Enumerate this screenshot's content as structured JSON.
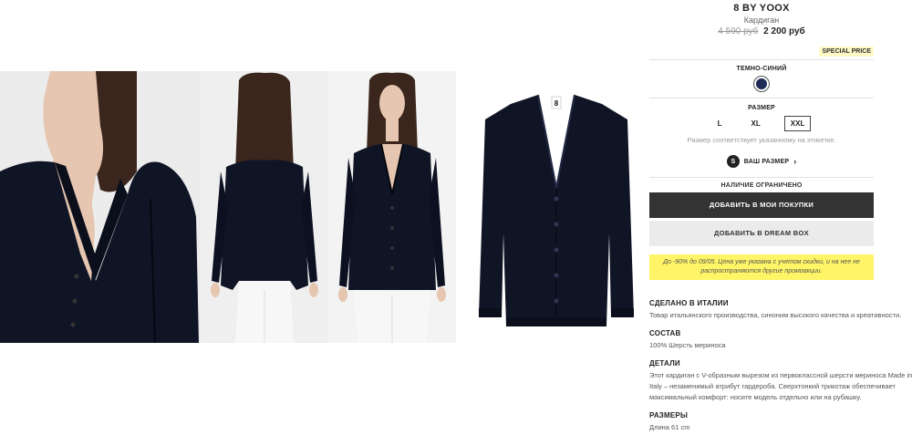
{
  "product": {
    "brand": "8 BY YOOX",
    "category": "Кардиган",
    "old_price": "4 590 руб",
    "new_price": "2 200 руб",
    "special_badge": "SPECIAL PRICE"
  },
  "color": {
    "label": "ТЕМНО-СИНИЙ",
    "swatch_hex": "#1d2b55"
  },
  "size": {
    "label": "РАЗМЕР",
    "options": [
      "L",
      "XL",
      "XXL"
    ],
    "selected": "XXL",
    "note": "Размер соответствует указанному на этикетке.",
    "your_size_badge": "S",
    "your_size_label": "ВАШ РАЗМЕР",
    "your_size_chevron": "›"
  },
  "stock": {
    "label": "НАЛИЧИЕ ОГРАНИЧЕНО"
  },
  "buttons": {
    "add_to_cart": "ДОБАВИТЬ В МОИ ПОКУПКИ",
    "add_to_dreambox": "ДОБАВИТЬ В DREAM BOX"
  },
  "promo": {
    "text": "До -90% до 09/05. Цена уже указана с учетом скидки, и на нее не распространяются другие промоакции."
  },
  "details": {
    "made_title": "СДЕЛАНО В ИТАЛИИ",
    "made_text": "Товар итальянского производства, синоним высокого качества и креативности.",
    "composition_title": "СОСТАВ",
    "composition_text": "100% Шерсть мериноса",
    "details_title": "ДЕТАЛИ",
    "details_text": "Этот кардиган с V-образным вырезом из первоклассной шерсти мериноса Made in Italy – незаменимый атрибут гардероба. Сверхтонкий трикотаж обеспечивает максимальный комфорт: носите модель отдельно или на рубашку.",
    "sizes_title": "РАЗМЕРЫ",
    "sizes_text": "Длина 61 cm"
  },
  "images": {
    "photo_1": "model-front-closeup",
    "photo_2": "model-back",
    "photo_3": "model-front",
    "flat": "cardigan-flat",
    "brand_tag_text": "8"
  },
  "colors": {
    "garment": "#101526",
    "skin": "#e6c6b1",
    "hair": "#3a261c",
    "jeans": "#f6f6f6",
    "promo_bg": "#fff566",
    "button_dark": "#333333"
  }
}
